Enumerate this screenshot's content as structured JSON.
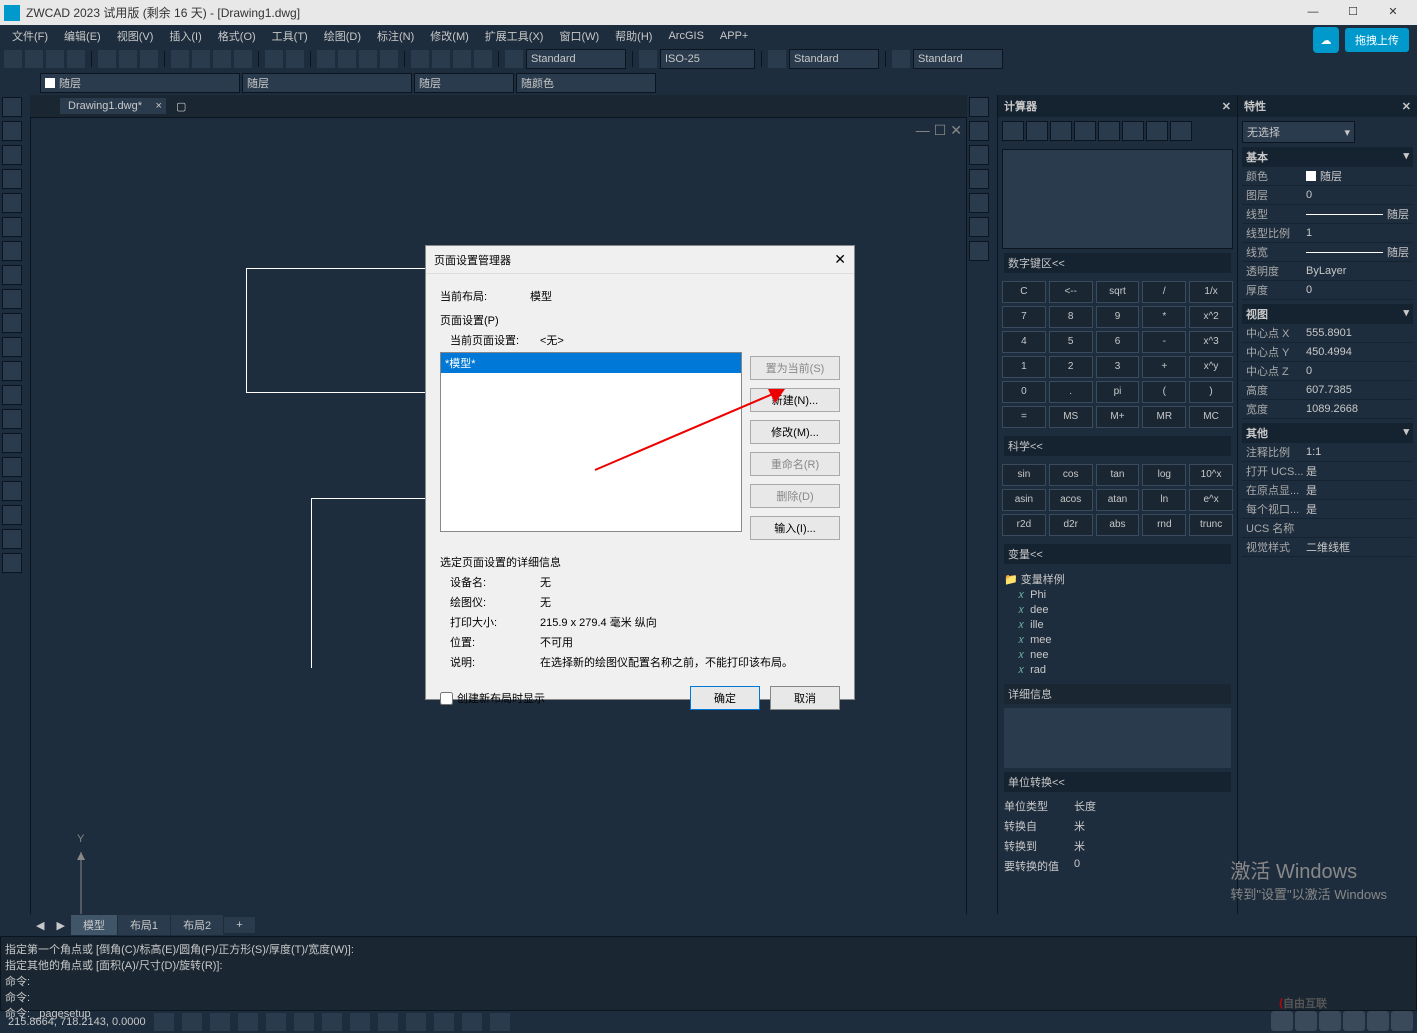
{
  "titlebar": {
    "app": "ZWCAD 2023 试用版 (剩余 16 天) - [Drawing1.dwg]"
  },
  "menu": [
    "文件(F)",
    "编辑(E)",
    "视图(V)",
    "插入(I)",
    "格式(O)",
    "工具(T)",
    "绘图(D)",
    "标注(N)",
    "修改(M)",
    "扩展工具(X)",
    "窗口(W)",
    "帮助(H)",
    "ArcGIS",
    "APP+"
  ],
  "upload": "拖拽上传",
  "styles": {
    "text": "Standard",
    "dim": "ISO-25",
    "table": "Standard",
    "ml": "Standard"
  },
  "layer": {
    "l1": "随层",
    "l2": "随层",
    "l3": "随层",
    "l4": "随颜色"
  },
  "filetab": "Drawing1.dwg*",
  "calc": {
    "title": "计算器",
    "sec1": "数字键区<<",
    "keys1": [
      "C",
      "<--",
      "sqrt",
      "/",
      "1/x",
      "7",
      "8",
      "9",
      "*",
      "x^2",
      "4",
      "5",
      "6",
      "-",
      "x^3",
      "1",
      "2",
      "3",
      "+",
      "x^y",
      "0",
      ".",
      "pi",
      "(",
      ")",
      "=",
      "MS",
      "M+",
      "MR",
      "MC"
    ],
    "sec2": "科学<<",
    "keys2": [
      "sin",
      "cos",
      "tan",
      "log",
      "10^x",
      "asin",
      "acos",
      "atan",
      "ln",
      "e^x",
      "r2d",
      "d2r",
      "abs",
      "rnd",
      "trunc"
    ],
    "sec3": "变量<<",
    "vartree": {
      "root": "变量样例",
      "items": [
        "Phi",
        "dee",
        "ille",
        "mee",
        "nee",
        "rad"
      ]
    },
    "sec4": "详细信息",
    "sec5": "单位转换<<",
    "units": [
      [
        "单位类型",
        "长度"
      ],
      [
        "转换自",
        "米"
      ],
      [
        "转换到",
        "米"
      ],
      [
        "要转换的值",
        "0"
      ]
    ]
  },
  "props": {
    "title": "特性",
    "sel": "无选择",
    "sec1": "基本",
    "rows1": [
      [
        "颜色",
        "随层"
      ],
      [
        "图层",
        "0"
      ],
      [
        "线型",
        "随层"
      ],
      [
        "线型比例",
        "1"
      ],
      [
        "线宽",
        "随层"
      ],
      [
        "透明度",
        "ByLayer"
      ],
      [
        "厚度",
        "0"
      ]
    ],
    "sec2": "视图",
    "rows2": [
      [
        "中心点 X",
        "555.8901"
      ],
      [
        "中心点 Y",
        "450.4994"
      ],
      [
        "中心点 Z",
        "0"
      ],
      [
        "高度",
        "607.7385"
      ],
      [
        "宽度",
        "1089.2668"
      ]
    ],
    "sec3": "其他",
    "rows3": [
      [
        "注释比例",
        "1:1"
      ],
      [
        "打开 UCS...",
        "是"
      ],
      [
        "在原点显...",
        "是"
      ],
      [
        "每个视口...",
        "是"
      ],
      [
        "UCS 名称",
        ""
      ],
      [
        "视觉样式",
        "二维线框"
      ]
    ]
  },
  "btabs": [
    "模型",
    "布局1",
    "布局2"
  ],
  "cmd": {
    "l1": "指定第一个角点或 [倒角(C)/标高(E)/圆角(F)/正方形(S)/厚度(T)/宽度(W)]:",
    "l2": "指定其他的角点或 [面积(A)/尺寸(D)/旋转(R)]:",
    "l3": "命令:",
    "l4": "命令:",
    "l5": "命令: _pagesetup"
  },
  "coords": "215.8664, 718.2143, 0.0000",
  "dialog": {
    "title": "页面设置管理器",
    "curlayout_l": "当前布局:",
    "curlayout_v": "模型",
    "ps_l": "页面设置(P)",
    "cps_l": "当前页面设置:",
    "cps_v": "<无>",
    "listitem": "*模型*",
    "btns": [
      "置为当前(S)",
      "新建(N)...",
      "修改(M)...",
      "重命名(R)",
      "删除(D)",
      "输入(I)..."
    ],
    "details_h": "选定页面设置的详细信息",
    "details": [
      [
        "设备名:",
        "无"
      ],
      [
        "绘图仪:",
        "无"
      ],
      [
        "打印大小:",
        "215.9 x 279.4 毫米 纵向"
      ],
      [
        "位置:",
        "不可用"
      ],
      [
        "说明:",
        "在选择新的绘图仪配置名称之前，不能打印该布局。"
      ]
    ],
    "chk": "创建新布局时显示",
    "ok": "确定",
    "cancel": "取消"
  },
  "watermark": {
    "l1": "激活 Windows",
    "l2": "转到\"设置\"以激活 Windows"
  },
  "brand": "自由互联"
}
